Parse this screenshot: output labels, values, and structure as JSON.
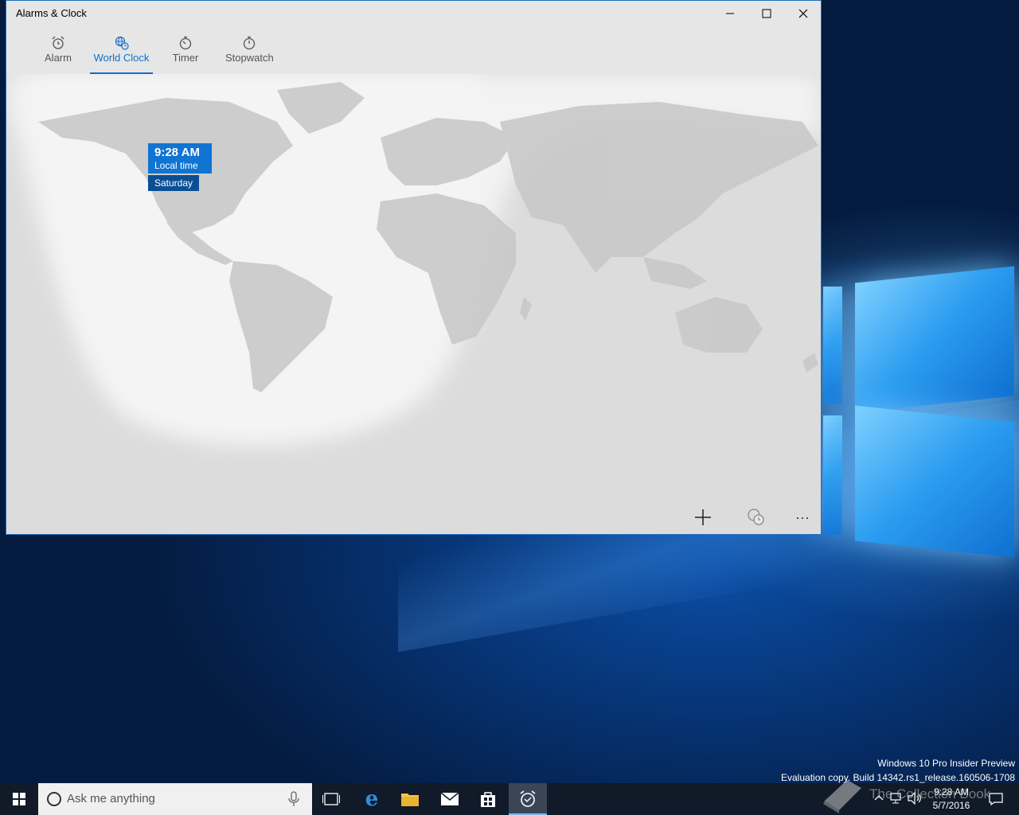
{
  "window": {
    "title": "Alarms & Clock",
    "controls": {
      "minimize": "minimize",
      "maximize": "maximize",
      "close": "close"
    }
  },
  "tabs": [
    {
      "label": "Alarm",
      "icon": "alarm-clock-icon",
      "active": false
    },
    {
      "label": "World Clock",
      "icon": "globe-clock-icon",
      "active": true
    },
    {
      "label": "Timer",
      "icon": "timer-icon",
      "active": false
    },
    {
      "label": "Stopwatch",
      "icon": "stopwatch-icon",
      "active": false
    }
  ],
  "world_clock": {
    "time": "9:28 AM",
    "label": "Local time",
    "day": "Saturday"
  },
  "appbar": {
    "add": "add-icon",
    "compare": "compare-clock-icon",
    "more": "···"
  },
  "watermark": {
    "line1": "Windows 10 Pro Insider Preview",
    "line2": "Evaluation copy. Build 14342.rs1_release.160506-1708"
  },
  "taskbar": {
    "search_placeholder": "Ask me anything",
    "clock_time": "9:28 AM",
    "clock_date": "5/7/2016",
    "overlay_text": "The Collection Book"
  },
  "colors": {
    "accent": "#0f74d2",
    "accent_dark": "#0a4f95",
    "taskbar": "#101a28"
  }
}
